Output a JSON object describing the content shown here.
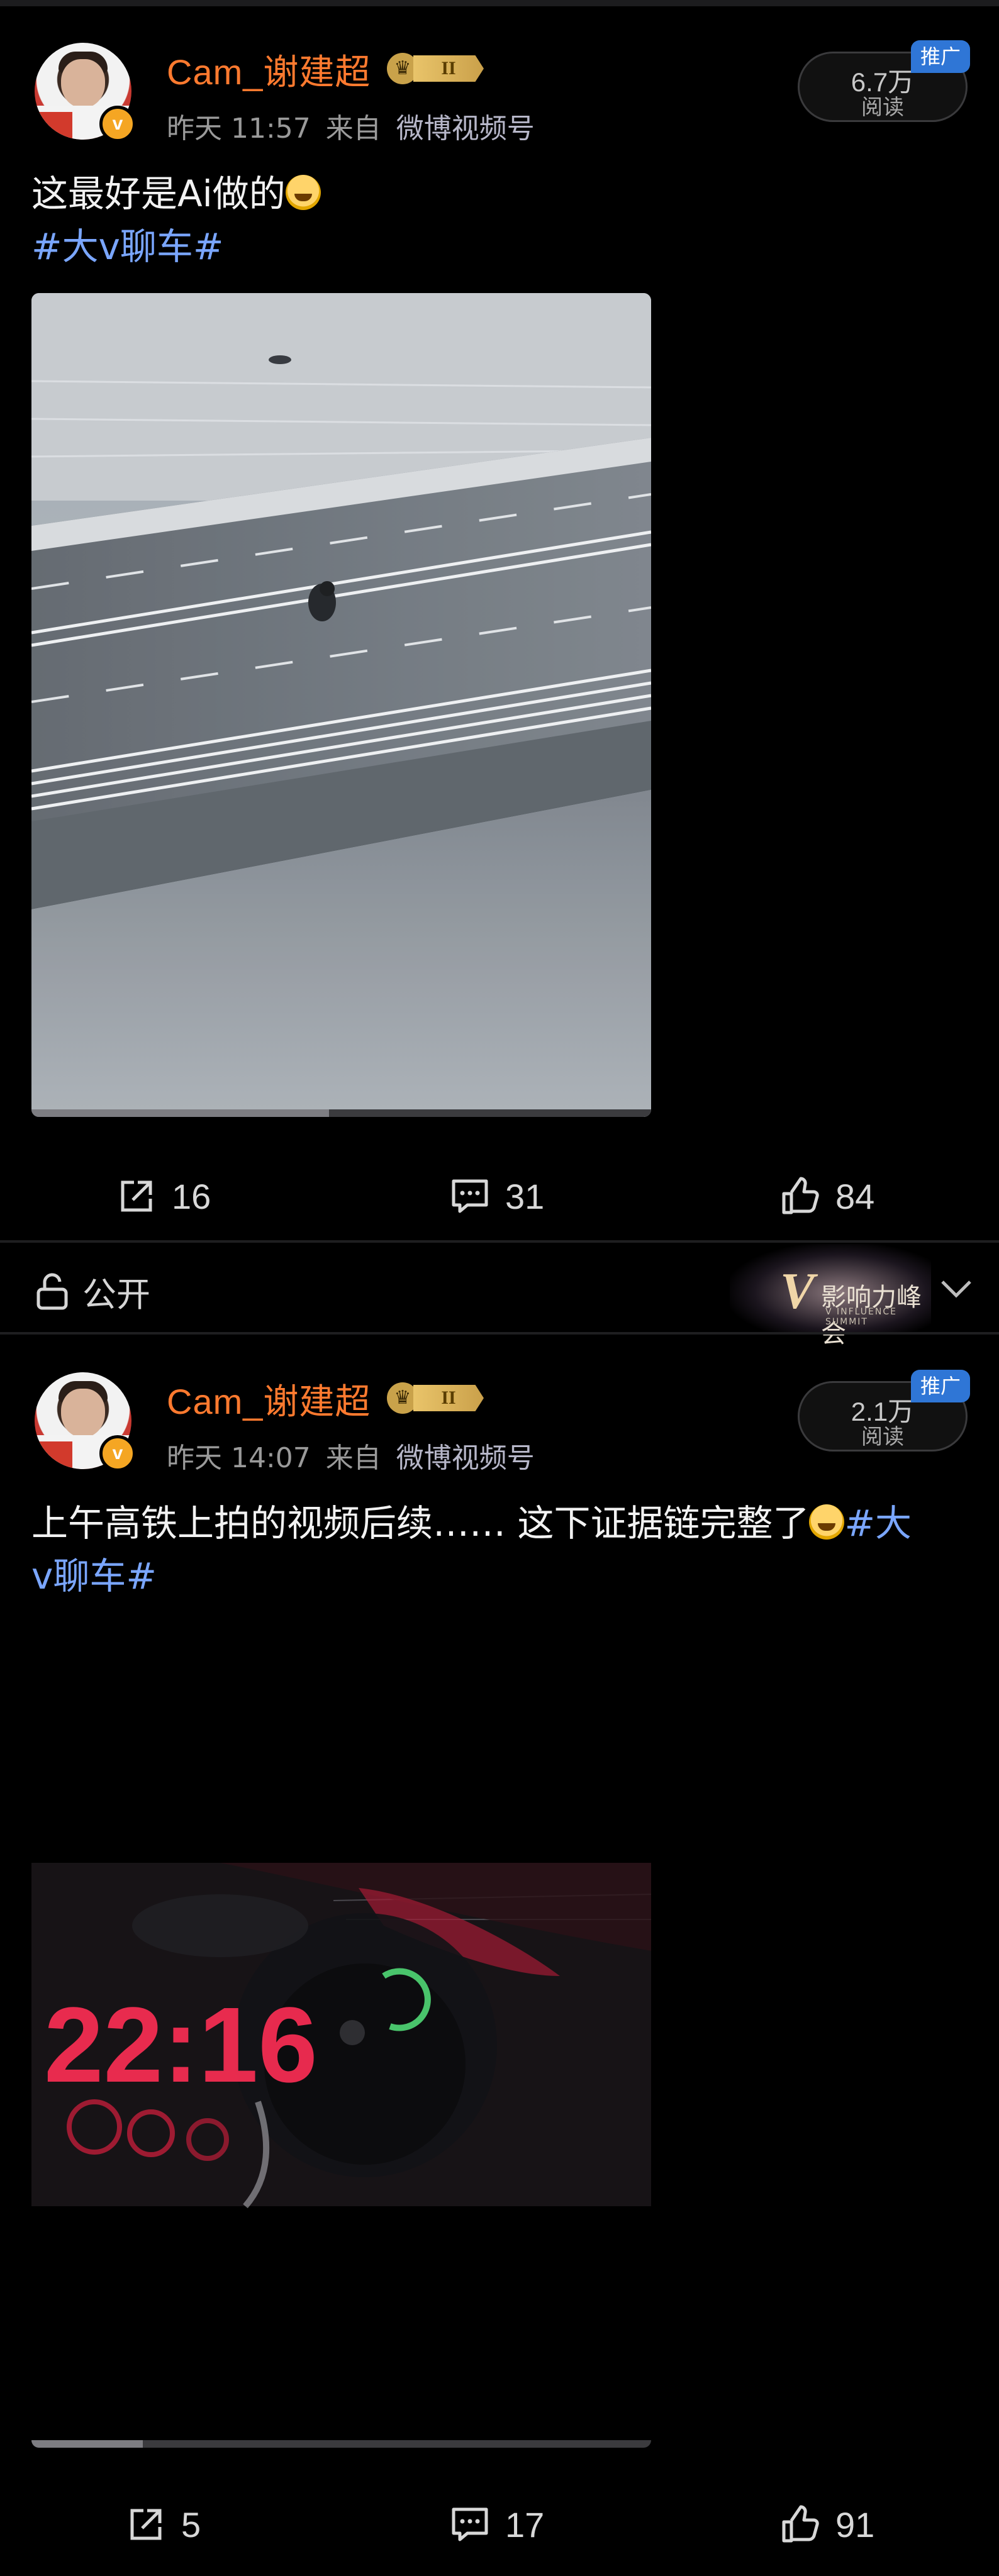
{
  "posts": [
    {
      "username": "Cam_谢建超",
      "level": "II",
      "time": "昨天 11:57",
      "from_label": "来自",
      "source": "微博视频号",
      "reads": {
        "count": "6.7万",
        "label": "阅读",
        "promo": "推广"
      },
      "text": "这最好是Ai做的",
      "hashtag": "#大v聊车#",
      "video_progress": 0.48,
      "actions": {
        "share": "16",
        "comment": "31",
        "like": "84"
      }
    },
    {
      "username": "Cam_谢建超",
      "level": "II",
      "time": "昨天 14:07",
      "from_label": "来自",
      "source": "微博视频号",
      "reads": {
        "count": "2.1万",
        "label": "阅读",
        "promo": "推广"
      },
      "text": "上午高铁上拍的视频后续…… 这下证据链完整了",
      "hashtag_part1": "#大",
      "hashtag_part2": "v聊车#",
      "video_overlay": "22:16",
      "video_progress": 0.18,
      "actions": {
        "share": "5",
        "comment": "17",
        "like": "91"
      }
    }
  ],
  "footer": {
    "visibility": "公开",
    "brand_v": "V",
    "brand_name": "影响力峰会",
    "brand_sub": "V INFLUENCE SUMMIT"
  },
  "colors": {
    "background": "#000000",
    "username": "#ff7a2f",
    "hashtag": "#7aa6ff",
    "promo_badge": "#2f76d6",
    "verified_badge": "#f5a623"
  }
}
